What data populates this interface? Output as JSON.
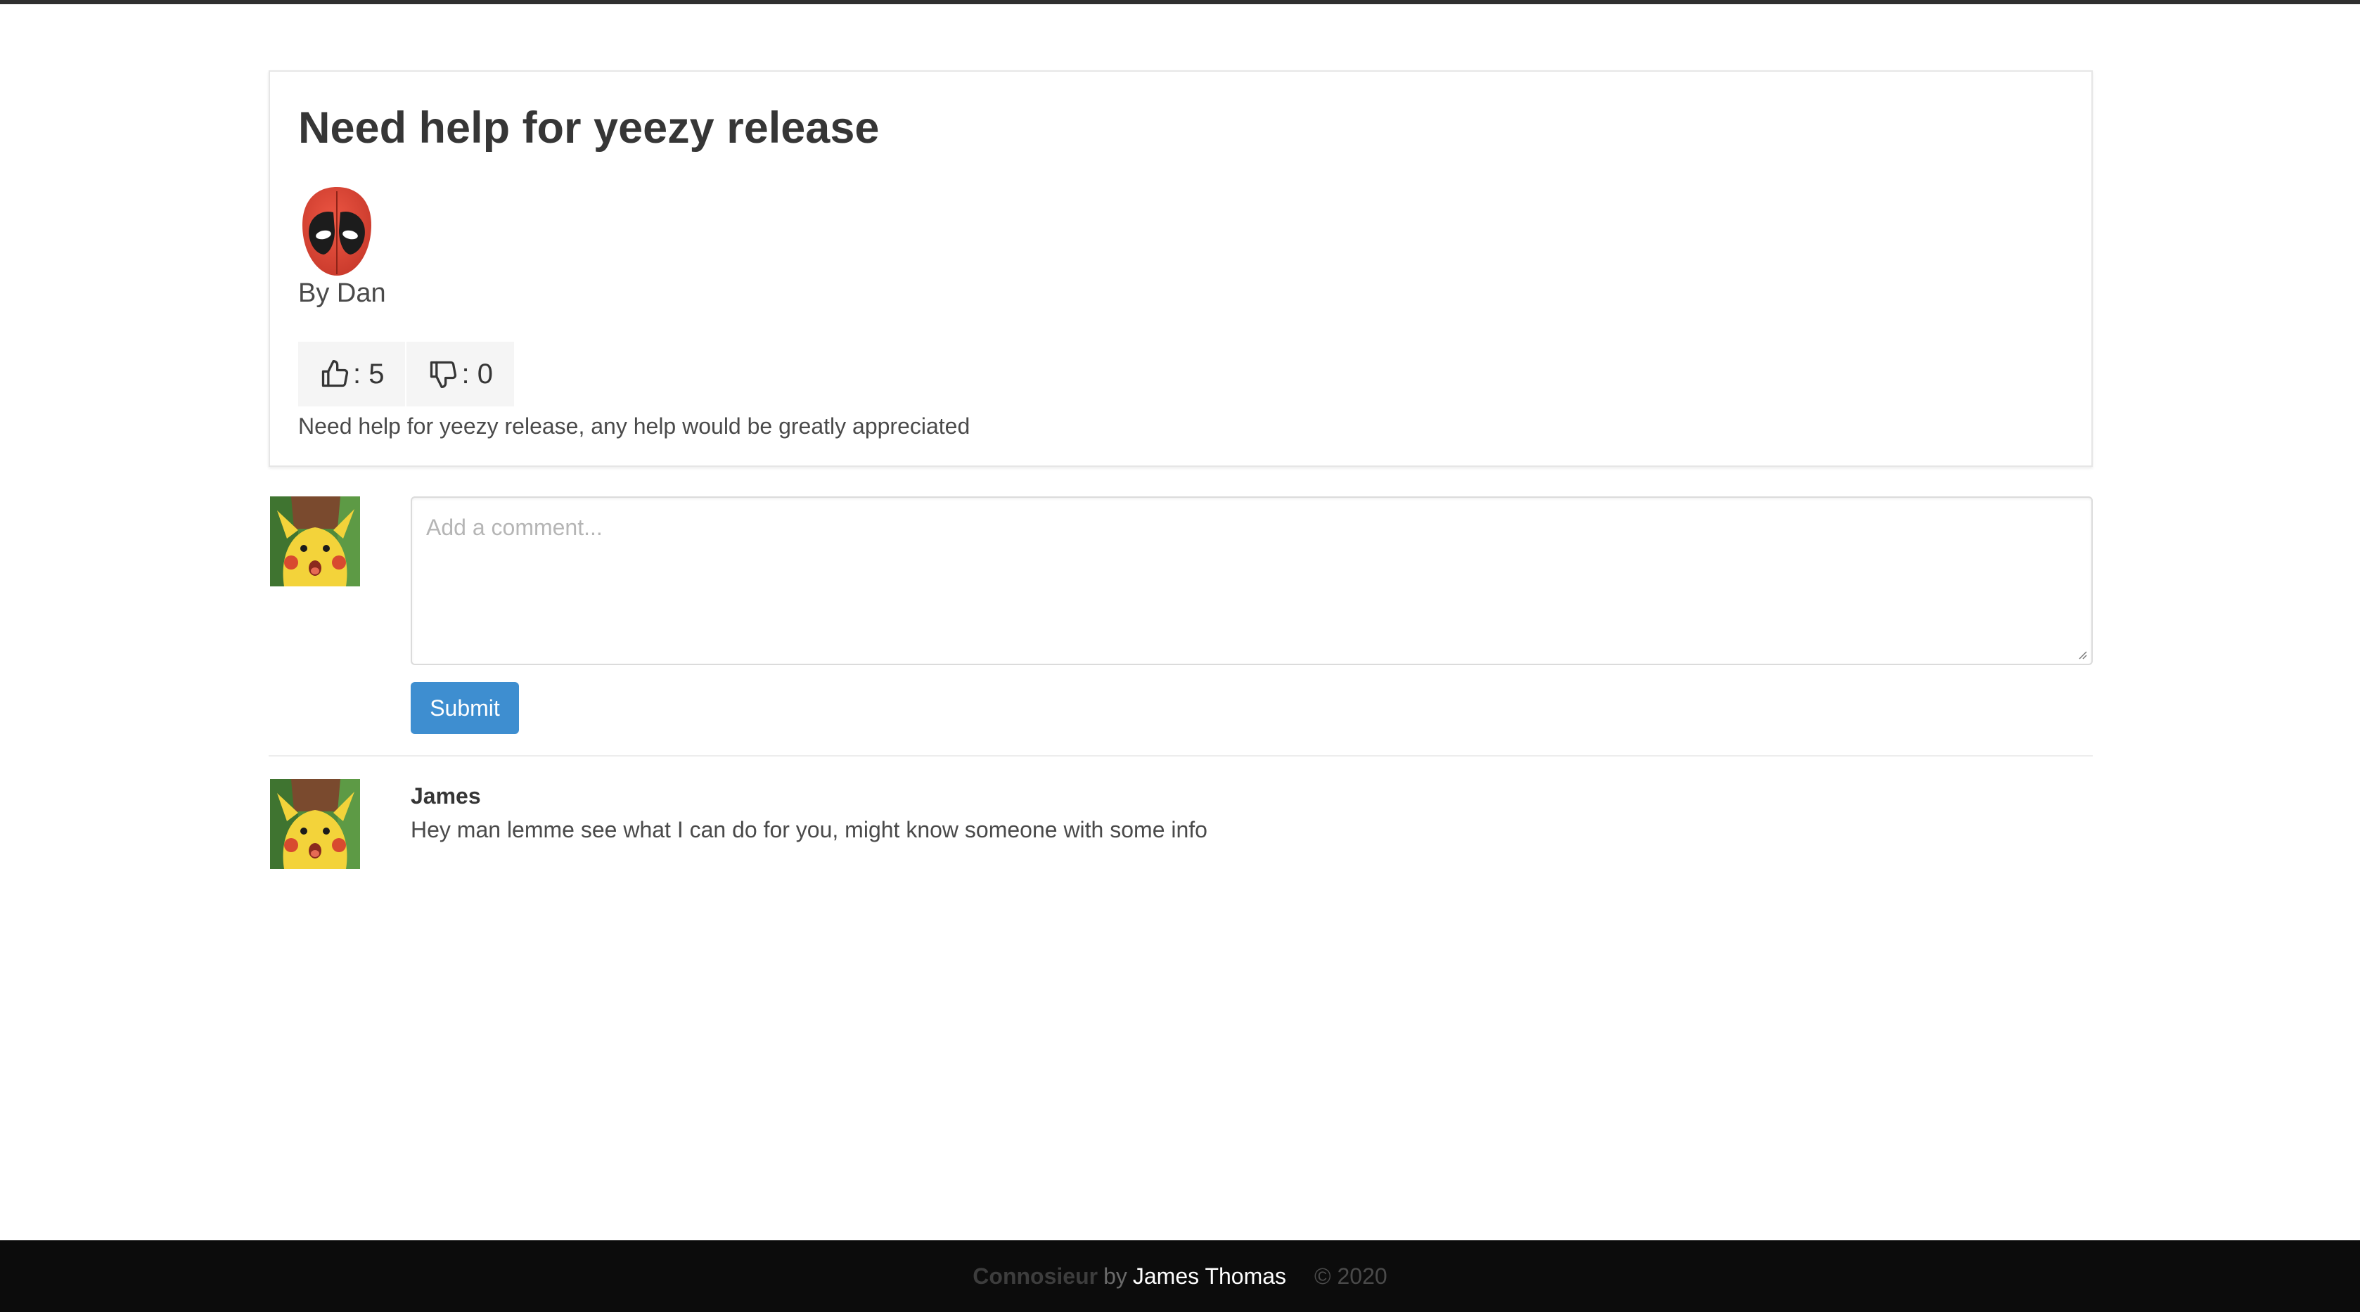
{
  "post": {
    "title": "Need help for yeezy release",
    "author_line": "By Dan",
    "author_avatar_icon": "deadpool-mask-avatar",
    "likes_label": ": 5",
    "dislikes_label": ": 0",
    "likes_icon": "thumbs-up-icon",
    "dislikes_icon": "thumbs-down-icon",
    "body": "Need help for yeezy release, any help would be greatly appreciated"
  },
  "comment_form": {
    "avatar_icon": "surprised-pikachu-avatar",
    "placeholder": "Add a comment...",
    "submit_label": "Submit"
  },
  "comments": [
    {
      "author": "James",
      "text": "Hey man lemme see what I can do for you, might know someone with some info",
      "avatar_icon": "surprised-pikachu-avatar"
    }
  ],
  "footer": {
    "brand": "Connosieur",
    "by": "by",
    "author": "James Thomas",
    "copyright": "© 2020"
  },
  "colors": {
    "primary_button": "#3e8ed0",
    "footer_bg": "#0c0c0c",
    "top_bar": "#2f2f2f"
  }
}
